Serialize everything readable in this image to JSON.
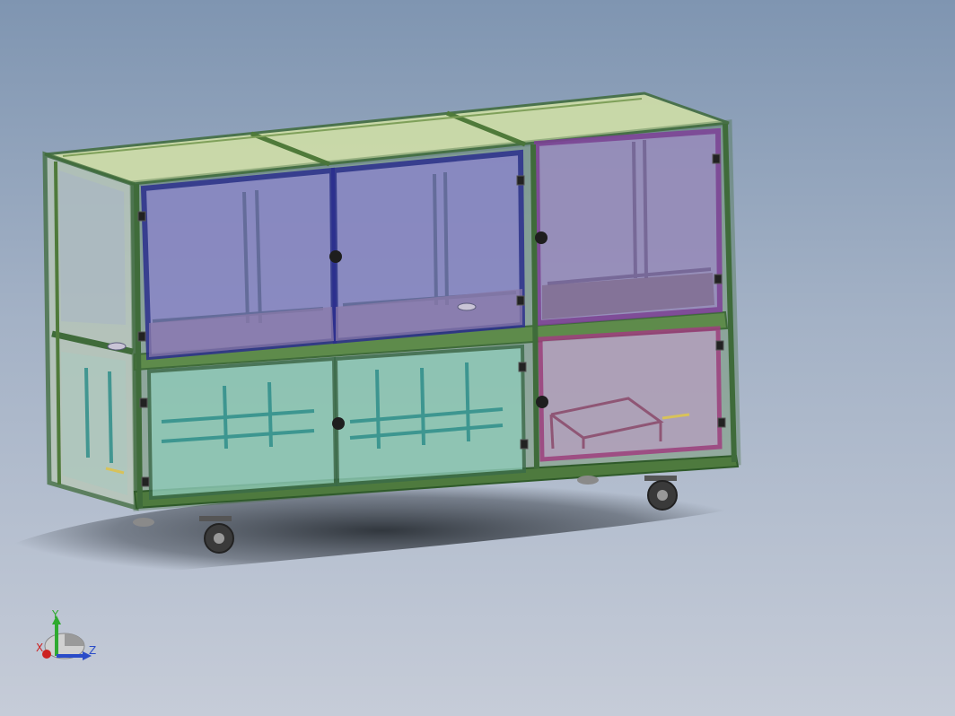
{
  "viewport": {
    "background_top": "#7f95b1",
    "background_bottom": "#c6ccd8"
  },
  "model": {
    "frame_color": "#3f6b3a",
    "frame_highlight": "#a9c58d",
    "top_glass_color": "#d3e2a6",
    "door_upper_glass_color": "#8a86c8",
    "door_upper_frame_color": "#2b2e8e",
    "door_right_upper_frame_color": "#7e3f98",
    "door_right_lower_frame_color": "#a03e7f",
    "lower_glass_color": "#8fcbb9",
    "lower_inner_frame_color": "#2f8e8a",
    "caster_icon": "caster-wheel-icon",
    "hinge_icon": "hinge-icon",
    "latch_icon": "latch-icon"
  },
  "triad": {
    "y_label": "Y",
    "x_label": "X",
    "z_label": "Z",
    "y_color": "#2faa2f",
    "x_color": "#cc2222",
    "z_color": "#2a4cc8"
  }
}
